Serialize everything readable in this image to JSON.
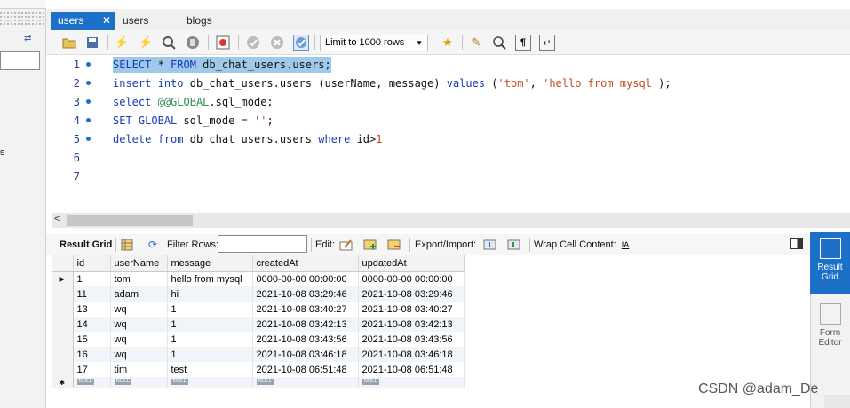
{
  "left_strip": {
    "arrows": "⇄",
    "letter": "s"
  },
  "tabs": [
    {
      "label": "users",
      "active": true,
      "close": "✕"
    },
    {
      "label": "users"
    },
    {
      "label": "blogs"
    }
  ],
  "toolbar": {
    "limit_select": "Limit to 1000 rows",
    "icons": [
      "folder-icon",
      "save-icon",
      "execute-icon",
      "execute-current-icon",
      "explain-icon",
      "stop-icon",
      "toggle-error-icon",
      "commit-icon",
      "rollback-icon",
      "autocommit-icon",
      "bookmark-icon",
      "beautify-icon",
      "find-icon",
      "invisible-chars-icon",
      "wrap-icon"
    ]
  },
  "editor": {
    "line_numbers": [
      "1",
      "2",
      "3",
      "4",
      "5",
      "6",
      "7"
    ],
    "lines": [
      {
        "kw1": "SELECT",
        "t1": " * ",
        "kw2": "FROM",
        "t2": " db_chat_users.users;"
      },
      {
        "kw1": "insert",
        "t1": " ",
        "kw2": "into",
        "t2": " db_chat_users.users (userName, message) ",
        "kw3": "values",
        "t3": " (",
        "s1": "'tom'",
        "t4": ", ",
        "s2": "'hello from mysql'",
        "t5": ");"
      },
      {
        "kw1": "select",
        "t1": " ",
        "v1": "@@GLOBAL",
        "t2": ".sql_mode;"
      },
      {
        "kw1": "SET",
        "t1": " ",
        "kw2": "GLOBAL",
        "t2": " sql_mode = ",
        "s1": "''",
        "t3": ";"
      },
      {
        "kw1": "delete",
        "t1": " ",
        "kw2": "from",
        "t2": " db_chat_users.users ",
        "kw3": "where",
        "t3": " id>",
        "n1": "1"
      }
    ]
  },
  "result_toolbar": {
    "result_grid": "Result Grid",
    "filter_rows": "Filter Rows:",
    "edit": "Edit:",
    "export_import": "Export/Import:",
    "wrap_cell": "Wrap Cell Content:",
    "wrap_icon_text": "IA"
  },
  "grid": {
    "columns": [
      "id",
      "userName",
      "message",
      "createdAt",
      "updatedAt"
    ],
    "rows": [
      [
        "1",
        "tom",
        "hello from mysql",
        "0000-00-00 00:00:00",
        "0000-00-00 00:00:00"
      ],
      [
        "11",
        "adam",
        "hi",
        "2021-10-08 03:29:46",
        "2021-10-08 03:29:46"
      ],
      [
        "13",
        "wq",
        "1",
        "2021-10-08 03:40:27",
        "2021-10-08 03:40:27"
      ],
      [
        "14",
        "wq",
        "1",
        "2021-10-08 03:42:13",
        "2021-10-08 03:42:13"
      ],
      [
        "15",
        "wq",
        "1",
        "2021-10-08 03:43:56",
        "2021-10-08 03:43:56"
      ],
      [
        "16",
        "wq",
        "1",
        "2021-10-08 03:46:18",
        "2021-10-08 03:46:18"
      ],
      [
        "17",
        "tim",
        "test",
        "2021-10-08 06:51:48",
        "2021-10-08 06:51:48"
      ]
    ],
    "current_row_marker": "▶",
    "new_row_marker": "✱",
    "null_label": "NULL"
  },
  "right_panel": {
    "result_grid": "Result\nGrid",
    "form_editor": "Form\nEditor"
  },
  "watermark": "CSDN @adam_De",
  "colors": {
    "accent": "#1c70c8",
    "selection": "#9fc9ea",
    "keyword": "#1a3bb5",
    "string": "#c64b24"
  }
}
